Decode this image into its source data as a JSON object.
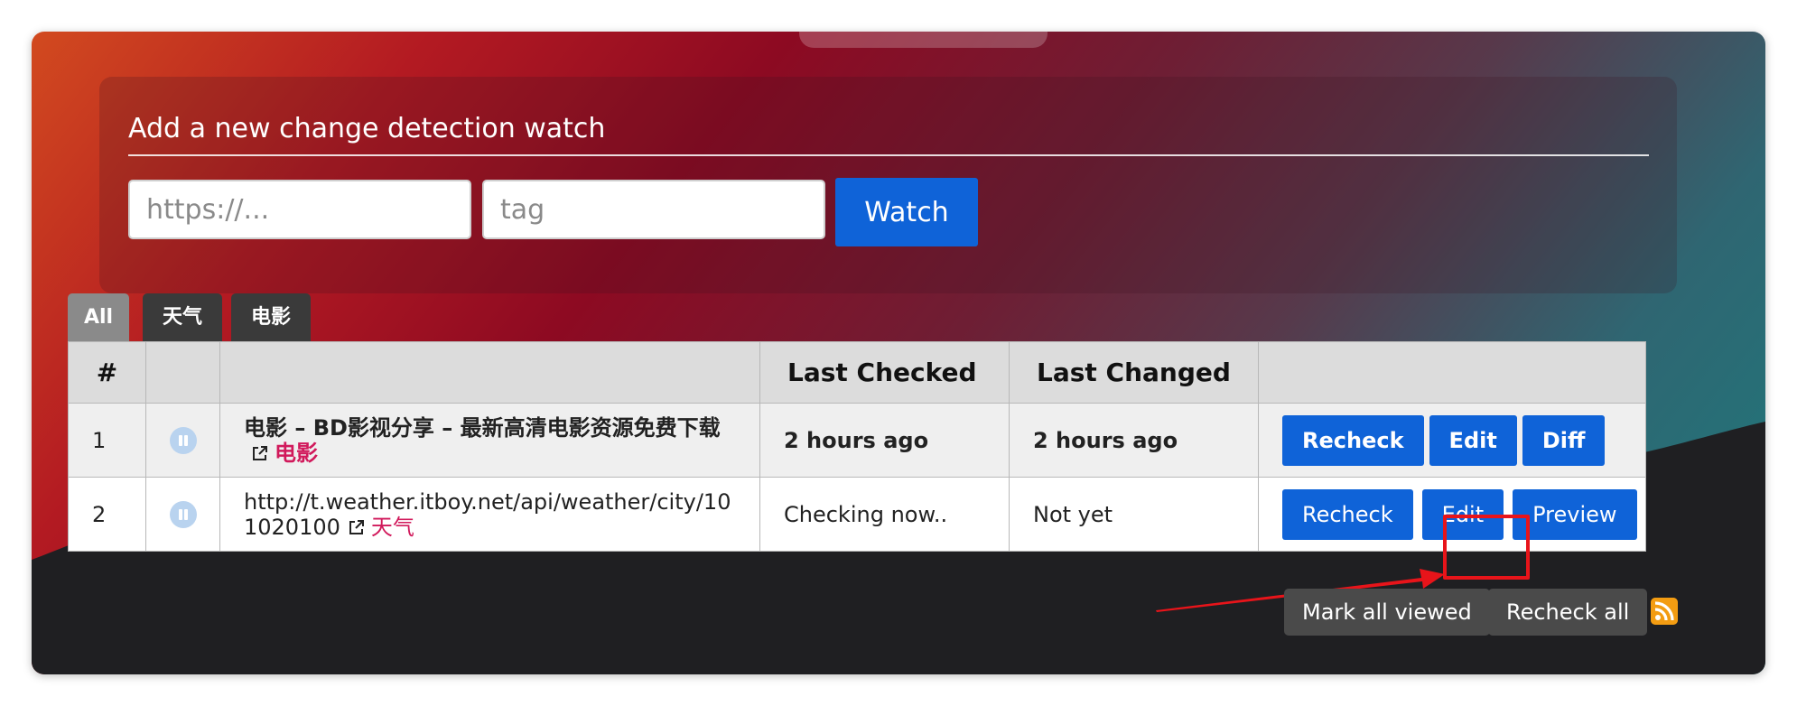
{
  "add_watch": {
    "title": "Add a new change detection watch",
    "url_placeholder": "https://...",
    "tag_placeholder": "tag",
    "watch_label": "Watch"
  },
  "tabs": [
    {
      "label": "All",
      "active": true
    },
    {
      "label": "天气",
      "active": false
    },
    {
      "label": "电影",
      "active": false
    }
  ],
  "table": {
    "headers": {
      "num": "#",
      "pause": "",
      "title": "",
      "last_checked": "Last Checked",
      "last_changed": "Last Changed",
      "actions": ""
    },
    "rows": [
      {
        "num": "1",
        "title": "电影 – BD影视分享 – 最新高清电影资源免费下载",
        "tag": "电影",
        "last_checked": "2 hours ago",
        "last_changed": "2 hours ago",
        "buttons": [
          "Recheck",
          "Edit",
          "Diff"
        ]
      },
      {
        "num": "2",
        "title": "http://t.weather.itboy.net/api/weather/city/101020100",
        "tag": "天气",
        "last_checked": "Checking now..",
        "last_changed": "Not yet",
        "buttons": [
          "Recheck",
          "Edit",
          "Preview"
        ]
      }
    ]
  },
  "footer": {
    "mark_all_viewed": "Mark all viewed",
    "recheck_all": "Recheck all"
  },
  "icons": {
    "pause": "pause-icon",
    "external_link": "external-link-icon",
    "rss": "rss-icon"
  },
  "colors": {
    "primary_button": "#0f63d8",
    "tag_text": "#d1195b",
    "annotation": "#e8141a",
    "rss": "#f39c12"
  }
}
